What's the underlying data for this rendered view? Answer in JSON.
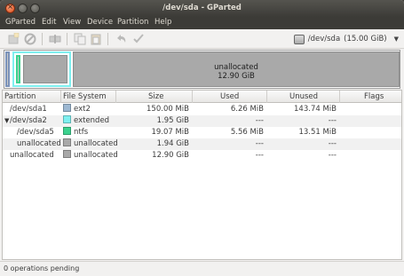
{
  "window": {
    "title": "/dev/sda - GParted",
    "close_glyph": "×"
  },
  "menubar": {
    "items": [
      "GParted",
      "Edit",
      "View",
      "Device",
      "Partition",
      "Help"
    ]
  },
  "toolbar": {
    "buttons": [
      "new-partition-icon",
      "delete-icon",
      "resize-move-icon",
      "copy-icon",
      "paste-icon",
      "undo-icon",
      "apply-icon"
    ],
    "device": {
      "name": "/dev/sda",
      "size": "(15.00 GiB)"
    }
  },
  "diskmap": {
    "unallocated_label": "unallocated",
    "unallocated_size": "12.90 GiB"
  },
  "colors": {
    "ext2": "#9db8d2",
    "extended": "#7ef0f0",
    "ntfs": "#3cd28f",
    "unallocated": "#a9a9a9"
  },
  "table": {
    "headers": [
      "Partition",
      "File System",
      "Size",
      "Used",
      "Unused",
      "Flags"
    ],
    "rows": [
      {
        "partition": "/dev/sda1",
        "fs": "ext2",
        "size": "150.00 MiB",
        "used": "6.26 MiB",
        "unused": "143.74 MiB",
        "flags": ""
      },
      {
        "partition": "/dev/sda2",
        "fs": "extended",
        "size": "1.95 GiB",
        "used": "---",
        "unused": "---",
        "flags": ""
      },
      {
        "partition": "/dev/sda5",
        "fs": "ntfs",
        "size": "19.07 MiB",
        "used": "5.56 MiB",
        "unused": "13.51 MiB",
        "flags": ""
      },
      {
        "partition": "unallocated",
        "fs": "unallocated",
        "size": "1.94 GiB",
        "used": "---",
        "unused": "---",
        "flags": ""
      },
      {
        "partition": "unallocated",
        "fs": "unallocated",
        "size": "12.90 GiB",
        "used": "---",
        "unused": "---",
        "flags": ""
      }
    ]
  },
  "status": {
    "text": "0 operations pending"
  }
}
